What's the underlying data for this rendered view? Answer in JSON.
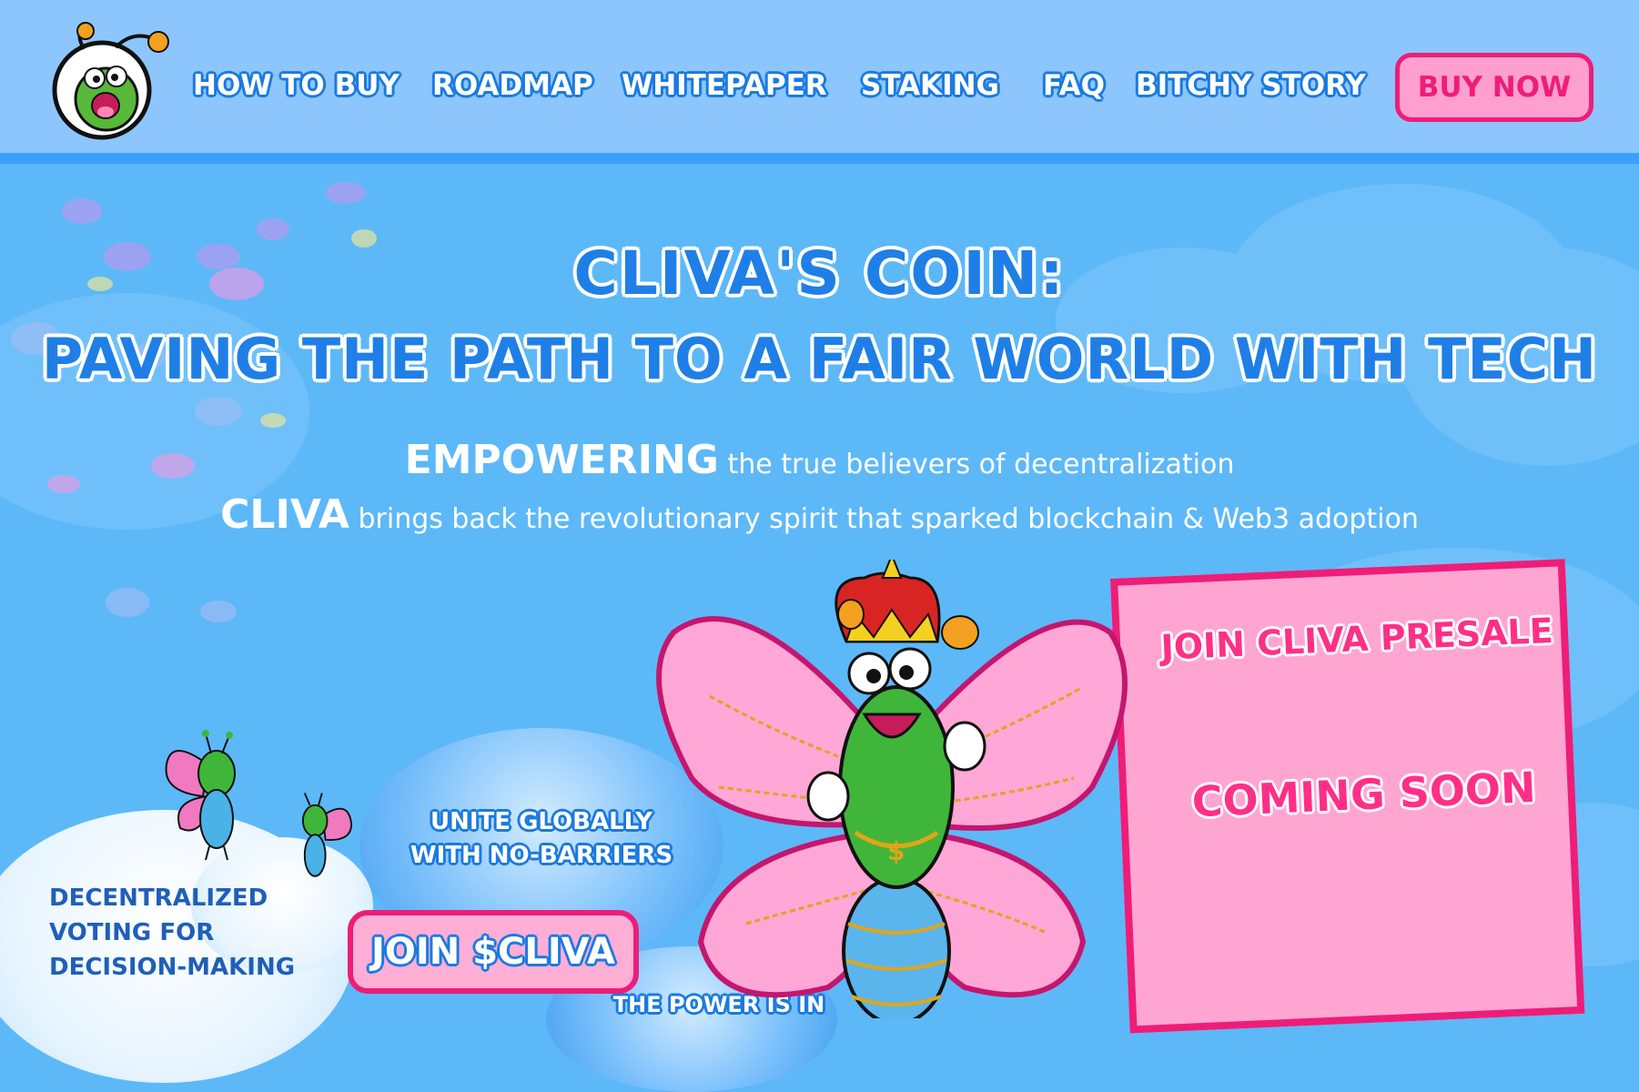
{
  "nav": {
    "items": [
      "HOW TO BUY",
      "ROADMAP",
      "WHITEPAPER",
      "STAKING",
      "FAQ",
      "BITCHY STORY"
    ],
    "buy_now": "BUY NOW"
  },
  "hero": {
    "title_line1": "CLIVA'S COIN:",
    "title_line2": "PAVING THE PATH TO A FAIR WORLD WITH TECH",
    "tagline1_strong": "EMPOWERING",
    "tagline1_rest": " the true believers of decentralization",
    "tagline2_strong": "CLIVA",
    "tagline2_rest": " brings back the revolutionary spirit that sparked blockchain & Web3 adoption"
  },
  "features": {
    "unite_line1": "UNITE GLOBALLY",
    "unite_line2": "WITH NO-BARRIERS",
    "voting_line1": "DECENTRALIZED",
    "voting_line2": "VOTING FOR",
    "voting_line3": "DECISION-MAKING",
    "power": "THE POWER IS IN"
  },
  "cta": {
    "join": "JOIN $CLIVA"
  },
  "presale": {
    "title": "JOIN CLIVA PRESALE",
    "status": "COMING SOON"
  },
  "icons": {
    "logo": "cliva-logo-icon",
    "mascot": "butterfly-mascot-icon"
  },
  "colors": {
    "header_bg": "#8cc6fd",
    "page_bg": "#5db8f8",
    "accent_pink": "#ee1d78",
    "button_pink": "#ff9fcf",
    "title_blue": "#1f7fe6"
  }
}
